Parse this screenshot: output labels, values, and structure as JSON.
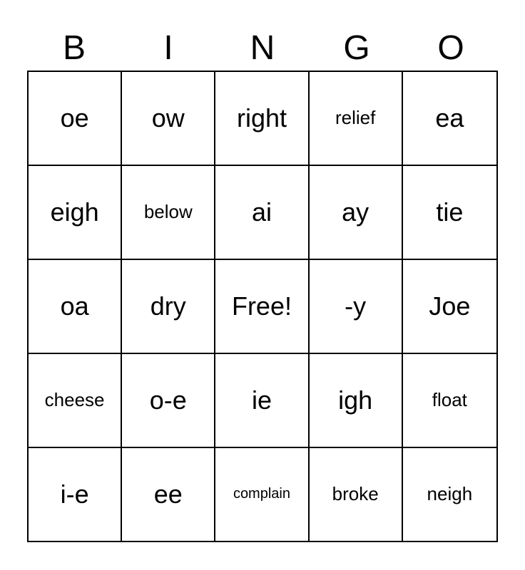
{
  "header": {
    "letters": [
      "B",
      "I",
      "N",
      "G",
      "O"
    ]
  },
  "grid": [
    [
      "oe",
      "ow",
      "right",
      "relief",
      "ea"
    ],
    [
      "eigh",
      "below",
      "ai",
      "ay",
      "tie"
    ],
    [
      "oa",
      "dry",
      "Free!",
      "-y",
      "Joe"
    ],
    [
      "cheese",
      "o-e",
      "ie",
      "igh",
      "float"
    ],
    [
      "i-e",
      "ee",
      "complain",
      "broke",
      "neigh"
    ]
  ],
  "small_cells": {
    "1-1": false,
    "1-2": false,
    "1-3": false,
    "1-4": true,
    "1-5": false,
    "2-1": false,
    "2-2": true,
    "4-1": true,
    "5-3": true
  }
}
